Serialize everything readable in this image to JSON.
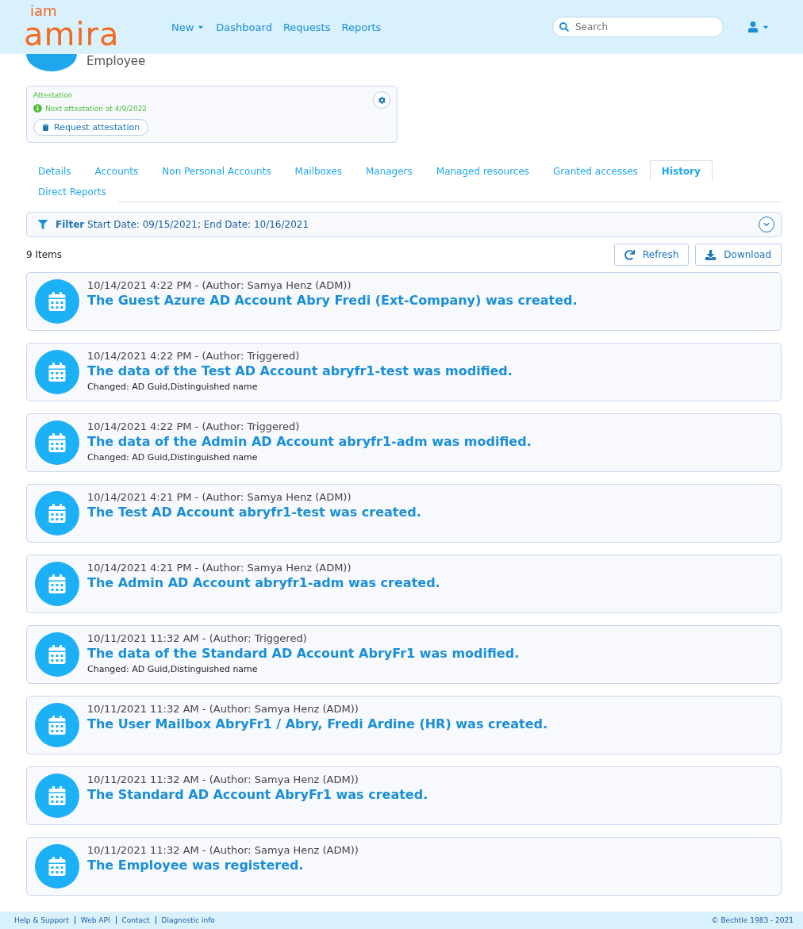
{
  "header": {
    "logo_top": "iam",
    "logo_main": "amira",
    "nav": [
      {
        "label": "New",
        "dropdown": true
      },
      {
        "label": "Dashboard",
        "dropdown": false
      },
      {
        "label": "Requests",
        "dropdown": false
      },
      {
        "label": "Reports",
        "dropdown": false
      }
    ],
    "search": {
      "placeholder": "Search"
    }
  },
  "profile": {
    "subtitle": "Employee"
  },
  "attestation": {
    "title": "Attestation",
    "info": "Next attestation at 4/9/2022",
    "button": "Request attestation"
  },
  "tabs": [
    {
      "label": "Details",
      "selected": false
    },
    {
      "label": "Accounts",
      "selected": false
    },
    {
      "label": "Non Personal Accounts",
      "selected": false
    },
    {
      "label": "Mailboxes",
      "selected": false
    },
    {
      "label": "Managers",
      "selected": false
    },
    {
      "label": "Managed resources",
      "selected": false
    },
    {
      "label": "Granted accesses",
      "selected": false
    },
    {
      "label": "History",
      "selected": true
    },
    {
      "label": "Direct Reports",
      "selected": false
    }
  ],
  "filter": {
    "label": "Filter",
    "text": "Start Date: 09/15/2021; End Date: 10/16/2021"
  },
  "count": "9 Items",
  "actions": [
    "Refresh",
    "Download"
  ],
  "events": [
    {
      "meta": "10/14/2021 4:22 PM - (Author: Samya Henz (ADM))",
      "title": "The Guest Azure AD Account Abry Fredi (Ext-Company) was created."
    },
    {
      "meta": "10/14/2021 4:22 PM - (Author: Triggered)",
      "title": "The data of the Test AD Account abryfr1-test was modified.",
      "detail": "Changed: AD Guid,Distinguished name"
    },
    {
      "meta": "10/14/2021 4:22 PM - (Author: Triggered)",
      "title": "The data of the Admin AD Account abryfr1-adm was modified.",
      "detail": "Changed: AD Guid,Distinguished name"
    },
    {
      "meta": "10/14/2021 4:21 PM - (Author: Samya Henz (ADM))",
      "title": "The Test AD Account abryfr1-test was created."
    },
    {
      "meta": "10/14/2021 4:21 PM - (Author: Samya Henz (ADM))",
      "title": "The Admin AD Account abryfr1-adm was created."
    },
    {
      "meta": "10/11/2021 11:32 AM - (Author: Triggered)",
      "title": "The data of the Standard AD Account AbryFr1 was modified.",
      "detail": "Changed: AD Guid,Distinguished name"
    },
    {
      "meta": "10/11/2021 11:32 AM - (Author: Samya Henz (ADM))",
      "title": "The User Mailbox AbryFr1 / Abry, Fredi Ardine (HR) was created."
    },
    {
      "meta": "10/11/2021 11:32 AM - (Author: Samya Henz (ADM))",
      "title": "The Standard AD Account AbryFr1 was created."
    },
    {
      "meta": "10/11/2021 11:32 AM - (Author: Samya Henz (ADM))",
      "title": "The Employee was registered."
    }
  ],
  "footer": {
    "links": [
      "Help & Support",
      "Web API",
      "Contact",
      "Diagnostic info"
    ],
    "copyright": "© Bechtle 1983 - 2021"
  }
}
